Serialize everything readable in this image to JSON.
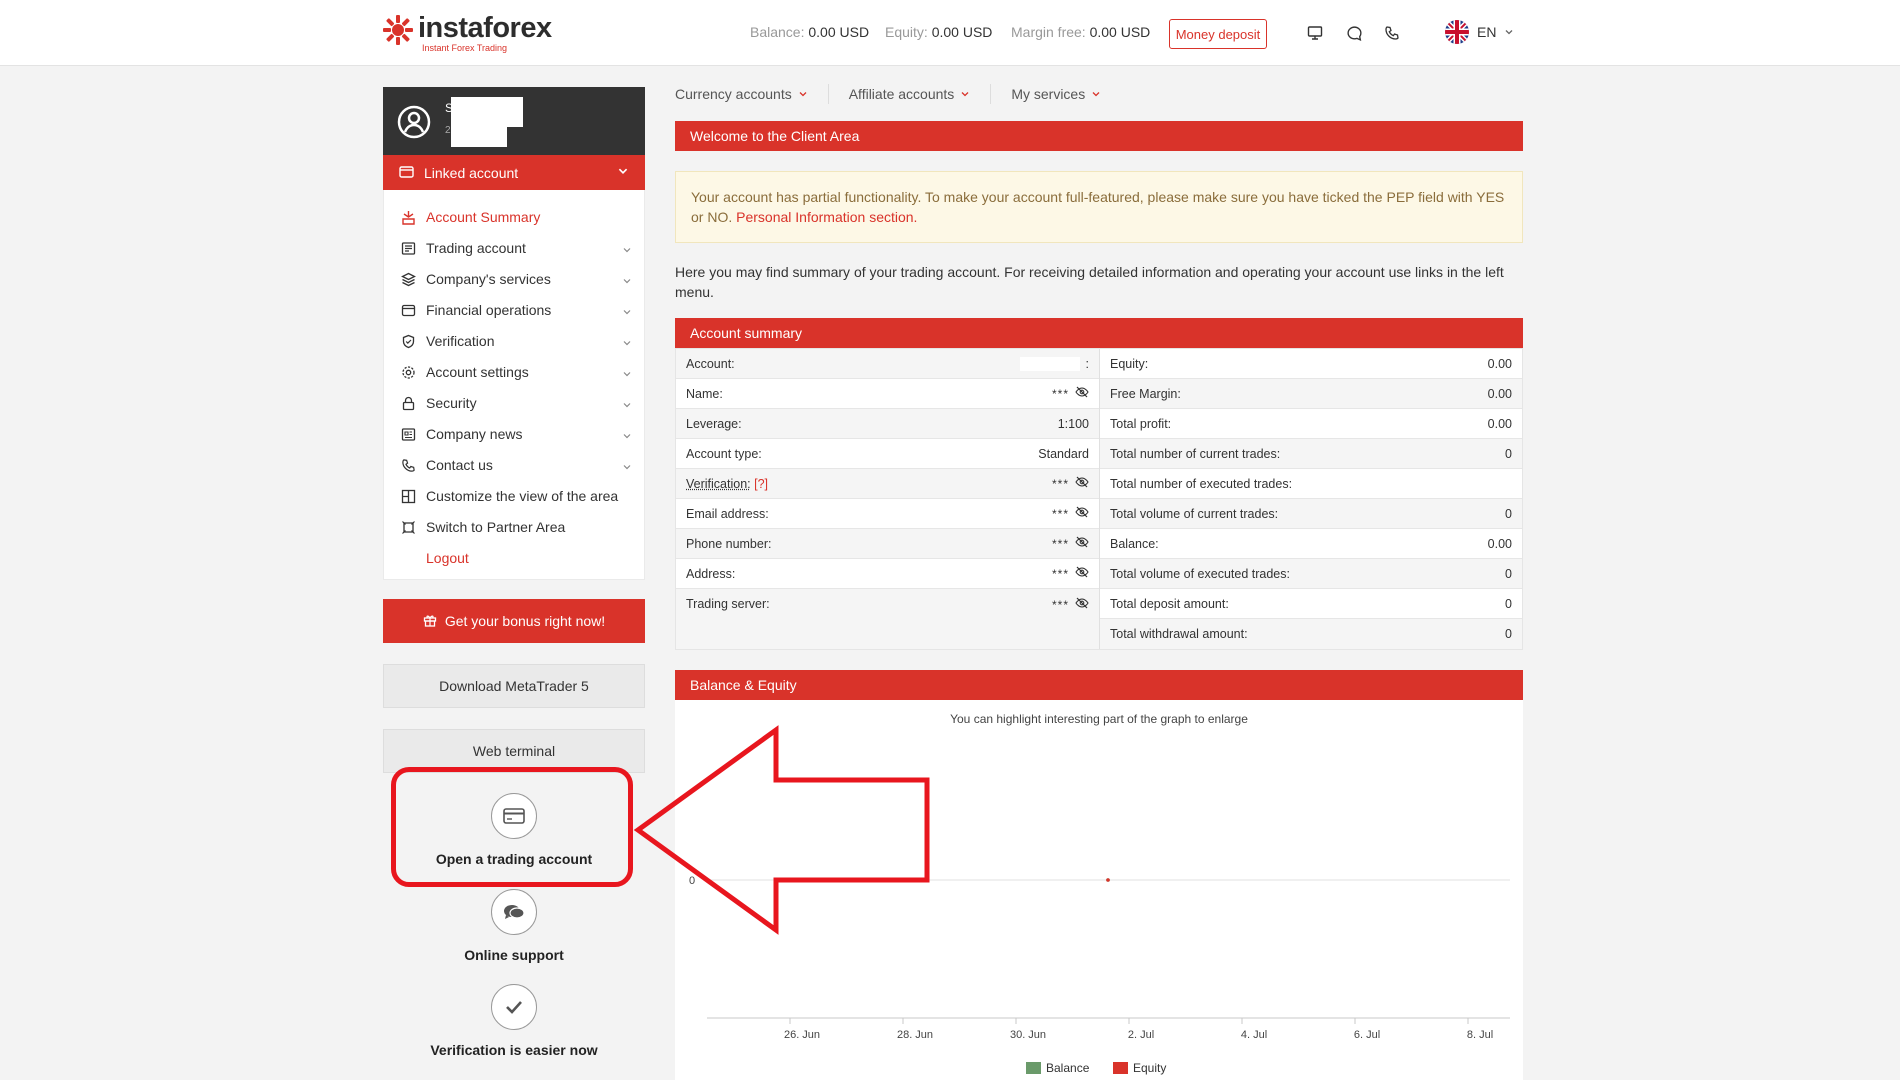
{
  "header": {
    "logo_name": "instaforex",
    "logo_tagline": "Instant Forex Trading",
    "balance_label": "Balance:",
    "balance_value": "0.00 USD",
    "equity_label": "Equity:",
    "equity_value": "0.00 USD",
    "margin_label": "Margin free:",
    "margin_value": "0.00 USD",
    "money_deposit": "Money deposit",
    "language": "EN"
  },
  "profile": {
    "initial": "S",
    "sub_initial": "2"
  },
  "sidebar": {
    "linked_account": "Linked account",
    "items": [
      {
        "label": "Account Summary",
        "icon": "summary-icon",
        "active": true,
        "chevron": false
      },
      {
        "label": "Trading account",
        "icon": "trading-account-icon",
        "chevron": true
      },
      {
        "label": "Company's services",
        "icon": "layers-icon",
        "chevron": true
      },
      {
        "label": "Financial operations",
        "icon": "wallet-icon",
        "chevron": true
      },
      {
        "label": "Verification",
        "icon": "shield-icon",
        "chevron": true
      },
      {
        "label": "Account settings",
        "icon": "gear-icon",
        "chevron": true
      },
      {
        "label": "Security",
        "icon": "lock-icon",
        "chevron": true
      },
      {
        "label": "Company news",
        "icon": "news-icon",
        "chevron": true
      },
      {
        "label": "Contact us",
        "icon": "phone-icon",
        "chevron": true
      },
      {
        "label": "Customize the view of the area",
        "icon": "grid-icon",
        "chevron": false
      },
      {
        "label": "Switch to Partner Area",
        "icon": "switch-icon",
        "chevron": false
      },
      {
        "label": "Logout",
        "icon": "",
        "chevron": false
      }
    ],
    "bonus_button": "Get your bonus right now!",
    "download_button": "Download MetaTrader 5",
    "web_terminal_button": "Web terminal",
    "open_account": "Open a trading account",
    "online_support": "Online support",
    "verification_easier": "Verification is easier now"
  },
  "tabs": [
    {
      "label": "Currency accounts"
    },
    {
      "label": "Affiliate accounts"
    },
    {
      "label": "My services"
    }
  ],
  "welcome": {
    "title": "Welcome to the Client Area",
    "notice_text": "Your account has partial functionality. To make your account full-featured, please make sure you have ticked the PEP field with YES or NO.",
    "notice_link": "Personal Information section.",
    "intro": "Here you may find summary of your trading account. For receiving detailed information and operating your account use links in the left menu."
  },
  "summary": {
    "title": "Account summary",
    "left": [
      {
        "label": "Account:",
        "value": ":",
        "hidden": false
      },
      {
        "label": "Name:",
        "value": "***",
        "hidden": true
      },
      {
        "label": "Leverage:",
        "value": "1:100",
        "hidden": false
      },
      {
        "label": "Account type:",
        "value": "Standard",
        "hidden": false
      },
      {
        "label": "Verification:",
        "value": "***",
        "hidden": true,
        "hint": "[?]"
      },
      {
        "label": "Email address:",
        "value": "***",
        "hidden": true
      },
      {
        "label": "Phone number:",
        "value": "***",
        "hidden": true
      },
      {
        "label": "Address:",
        "value": "***",
        "hidden": true
      },
      {
        "label": "Trading server:",
        "value": "***",
        "hidden": true
      }
    ],
    "right": [
      {
        "label": "Equity:",
        "value": "0.00"
      },
      {
        "label": "Free Margin:",
        "value": "0.00"
      },
      {
        "label": "Total profit:",
        "value": "0.00"
      },
      {
        "label": "Total number of current trades:",
        "value": "0"
      },
      {
        "label": "Total number of executed trades:",
        "value": ""
      },
      {
        "label": "Total volume of current trades:",
        "value": "0"
      },
      {
        "label": "Balance:",
        "value": "0.00"
      },
      {
        "label": "Total volume of executed trades:",
        "value": "0"
      },
      {
        "label": "Total deposit amount:",
        "value": "0"
      },
      {
        "label": "Total withdrawal amount:",
        "value": "0"
      }
    ]
  },
  "balance_equity": {
    "title": "Balance & Equity",
    "hint": "You can highlight interesting part of the graph to enlarge"
  },
  "chart_data": {
    "type": "line",
    "x": [
      "26. Jun",
      "28. Jun",
      "30. Jun",
      "2. Jul",
      "4. Jul",
      "6. Jul",
      "8. Jul"
    ],
    "y_ticks": [
      "0"
    ],
    "series": [
      {
        "name": "Balance",
        "color": "#6a9a6a",
        "values": [
          0
        ]
      },
      {
        "name": "Equity",
        "color": "#d9332a",
        "values": [
          0
        ]
      }
    ],
    "legend": "bottom"
  },
  "colors": {
    "accent": "#d9332a",
    "dark": "#333333",
    "highlight": "#e8161e"
  }
}
